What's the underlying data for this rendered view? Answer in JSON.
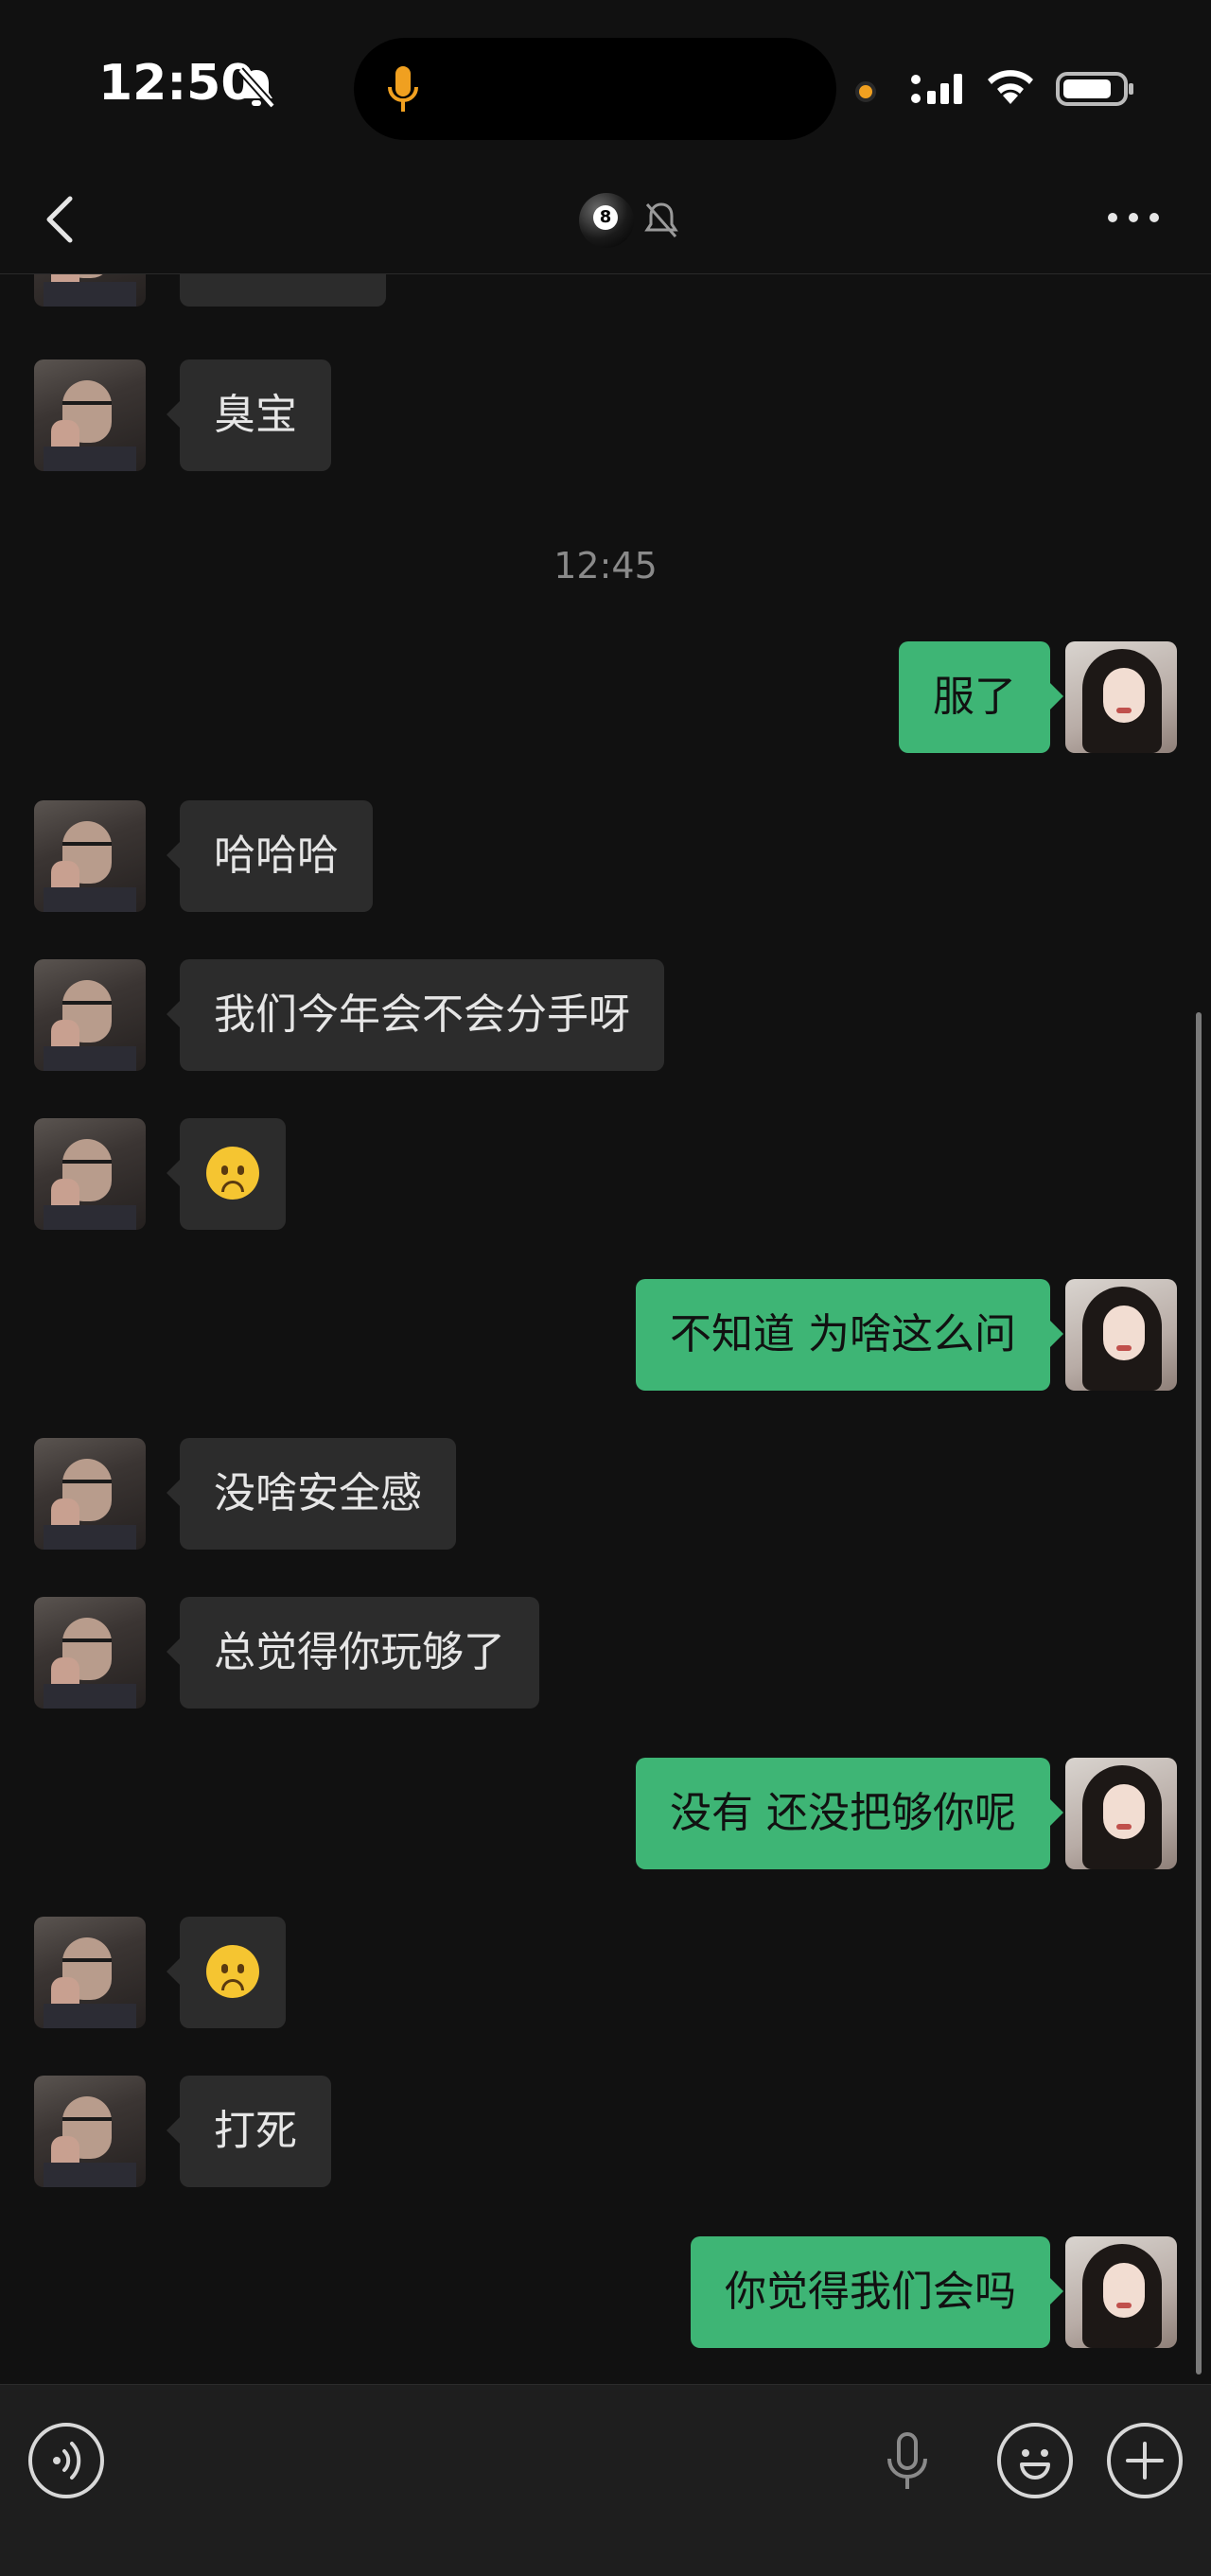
{
  "status_bar": {
    "time": "12:50"
  },
  "chat": {
    "timestamp": "12:45",
    "messages": [
      {
        "sender": "other",
        "text": "臭宝"
      },
      {
        "sender": "me",
        "text": "服了"
      },
      {
        "sender": "other",
        "text": "哈哈哈"
      },
      {
        "sender": "other",
        "text": "我们今年会不会分手呀"
      },
      {
        "sender": "other",
        "emoji": "sad-face"
      },
      {
        "sender": "me",
        "text": "不知道 为啥这么问"
      },
      {
        "sender": "other",
        "text": "没啥安全感"
      },
      {
        "sender": "other",
        "text": "总觉得你玩够了"
      },
      {
        "sender": "me",
        "text": "没有 还没把够你呢"
      },
      {
        "sender": "other",
        "emoji": "sad-face"
      },
      {
        "sender": "other",
        "text": "打死"
      },
      {
        "sender": "me",
        "text": "你觉得我们会吗"
      }
    ]
  },
  "colors": {
    "my_bubble": "#3eb575",
    "their_bubble": "#2c2c2c",
    "background": "#111111"
  },
  "icons": [
    "bell-muted-icon",
    "mic-icon",
    "signal-icon",
    "wifi-icon",
    "battery-icon",
    "back-icon",
    "eight-ball-icon",
    "more-icon",
    "voice-icon",
    "emoji-icon",
    "plus-icon",
    "sad-emoji-icon"
  ]
}
